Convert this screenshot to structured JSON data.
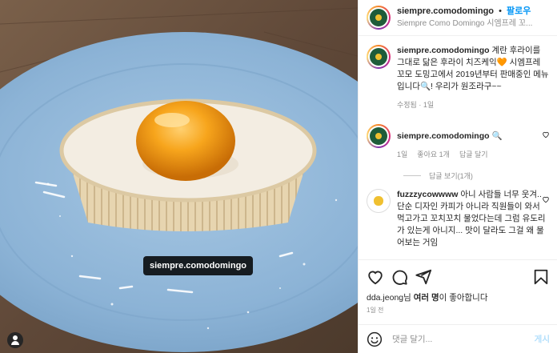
{
  "photo": {
    "tag_label": "siempre.comodomingo",
    "colors": {
      "plate": "#8fb6d8",
      "egg_yolk": "#f5a21a",
      "cake": "#f3ede2",
      "wood": "#6b5340"
    }
  },
  "header": {
    "username": "siempre.comodomingo",
    "dot": "•",
    "follow_label": "팔로우",
    "subtitle": "Siempre Como Domingo 시엠프레 꼬..."
  },
  "caption": {
    "username": "siempre.comodomingo",
    "text": "계란 후라이를 그대로 닮은 후라이 치즈케익🧡 시엠프레 꼬모 도밍고에서 2019년부터 판매중인 메뉴입니다🔍! 우리가 원조라구~~",
    "meta": "수정됨 · 1일"
  },
  "comments": [
    {
      "username": "siempre.comodomingo",
      "text": "🔍",
      "meta": [
        "1일",
        "좋아요 1개",
        "답글 달기"
      ],
      "replies": "답글 보기(1개)"
    },
    {
      "username": "fuzzzycowwww",
      "text": "아니 사람들 너무 웃겨.. 단순 디자인 카피가 아니라 직원들이 와서 먹고가고 꼬치꼬치 물었다는데 그럼 유도리가 있는게 아니지... 맛이 달라도 그걸 왜 물어보는 거임"
    }
  ],
  "actions": {
    "icons": [
      "heart-icon",
      "comment-icon",
      "share-icon",
      "bookmark-icon"
    ],
    "likes_user": "dda.jeong",
    "likes_mid": "님 ",
    "likes_bold": "여러 명",
    "likes_suffix": "이 좋아합니다",
    "time": "1일 전"
  },
  "add_comment": {
    "placeholder": "댓글 달기...",
    "post_label": "게시"
  }
}
